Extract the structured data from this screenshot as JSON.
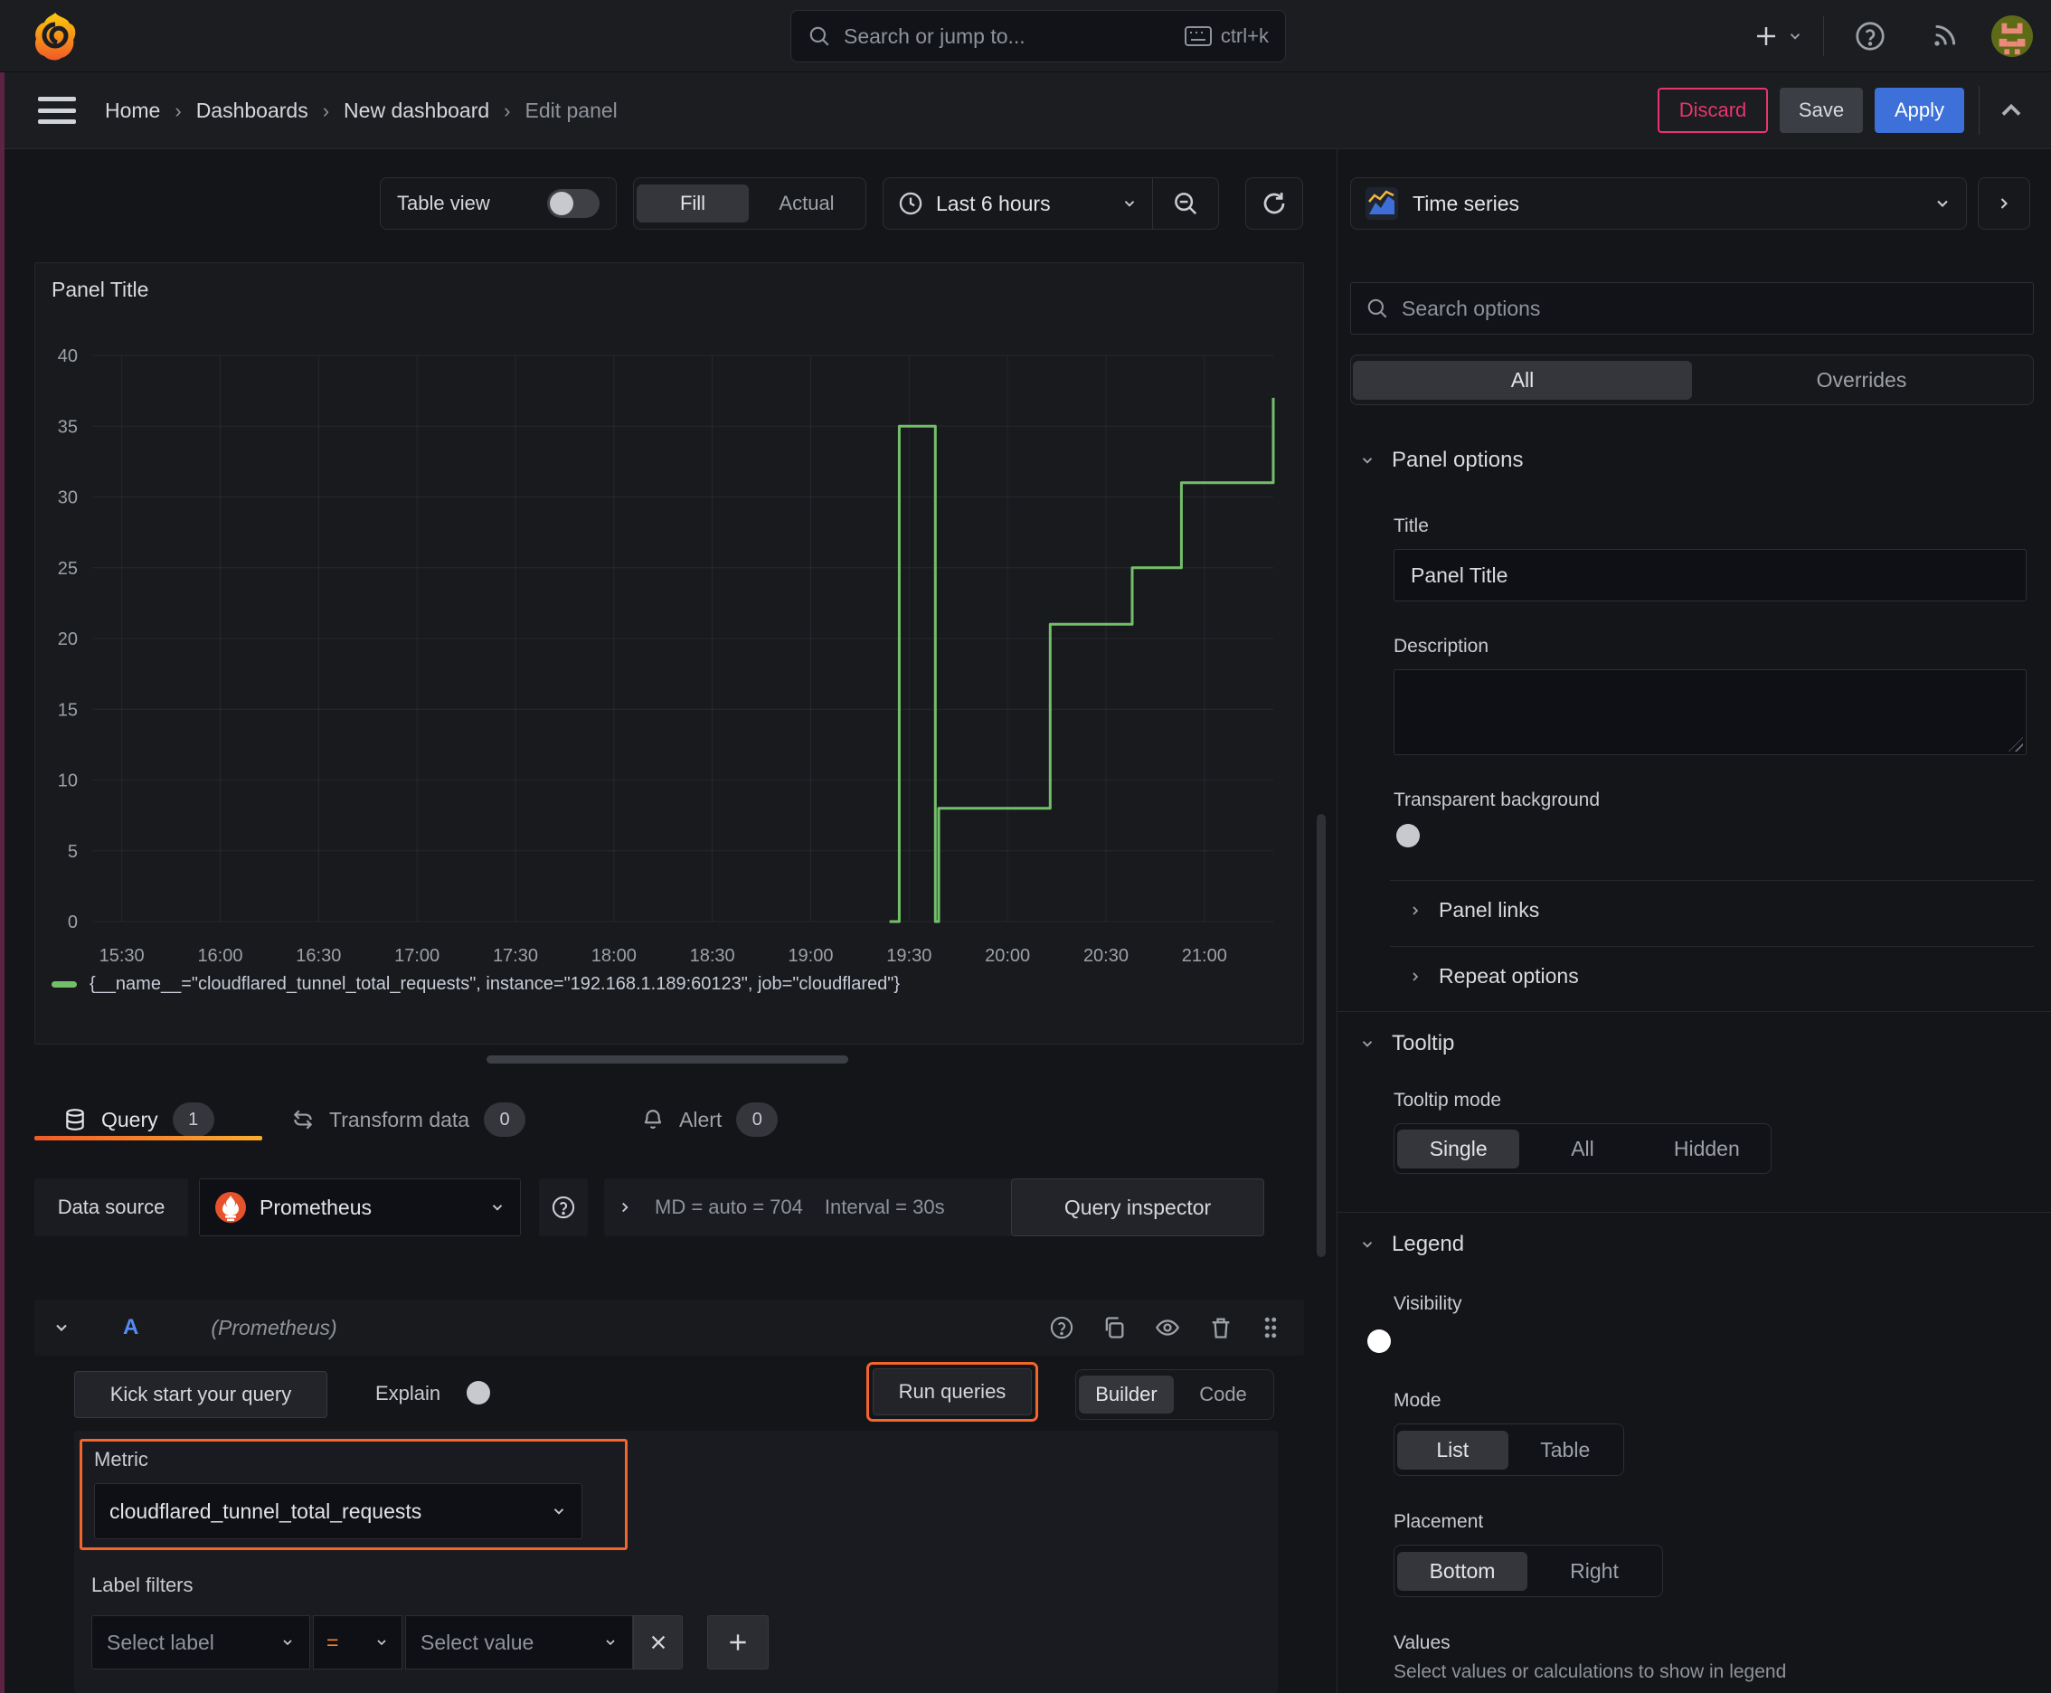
{
  "topbar": {
    "search_placeholder": "Search or jump to...",
    "search_shortcut": "ctrl+k"
  },
  "breadcrumb": {
    "items": [
      "Home",
      "Dashboards",
      "New dashboard",
      "Edit panel"
    ],
    "separator": "›"
  },
  "actions": {
    "discard": "Discard",
    "save": "Save",
    "apply": "Apply"
  },
  "toolbar": {
    "table_view_label": "Table view",
    "fill_label": "Fill",
    "actual_label": "Actual",
    "time_range_label": "Last 6 hours"
  },
  "panel": {
    "title": "Panel Title"
  },
  "chart_data": {
    "type": "line",
    "step": true,
    "title": "Panel Title",
    "x_range": [
      "15:21",
      "21:21"
    ],
    "x_ticks": [
      "15:30",
      "16:00",
      "16:30",
      "17:00",
      "17:30",
      "18:00",
      "18:30",
      "19:00",
      "19:30",
      "20:00",
      "20:30",
      "21:00"
    ],
    "ylim": [
      0,
      40
    ],
    "y_tick_step": 5,
    "grid": true,
    "legend_position": "bottom",
    "series": [
      {
        "name": "{__name__=\"cloudflared_tunnel_total_requests\", instance=\"192.168.1.189:60123\", job=\"cloudflared\"}",
        "color": "#73bf69",
        "points": [
          [
            "19:24",
            0
          ],
          [
            "19:27",
            0
          ],
          [
            "19:27",
            35
          ],
          [
            "19:38",
            35
          ],
          [
            "19:38",
            0
          ],
          [
            "19:39",
            0
          ],
          [
            "19:39",
            8
          ],
          [
            "20:13",
            8
          ],
          [
            "20:13",
            21
          ],
          [
            "20:38",
            21
          ],
          [
            "20:38",
            25
          ],
          [
            "20:53",
            25
          ],
          [
            "20:53",
            31
          ],
          [
            "21:21",
            31
          ],
          [
            "21:21",
            37
          ]
        ]
      }
    ]
  },
  "tabs": [
    {
      "label": "Query",
      "count": "1"
    },
    {
      "label": "Transform data",
      "count": "0"
    },
    {
      "label": "Alert",
      "count": "0"
    }
  ],
  "query": {
    "datasource_label": "Data source",
    "datasource_value": "Prometheus",
    "options_md": "MD = auto = 704",
    "options_interval": "Interval = 30s",
    "inspector_label": "Query inspector",
    "row_id": "A",
    "row_datasource": "(Prometheus)",
    "kick_start_label": "Kick start your query",
    "explain_label": "Explain",
    "run_queries_label": "Run queries",
    "builder_label": "Builder",
    "code_label": "Code",
    "metric_label": "Metric",
    "metric_value": "cloudflared_tunnel_total_requests",
    "label_filters_label": "Label filters",
    "select_label_placeholder": "Select label",
    "operator": "=",
    "select_value_placeholder": "Select value"
  },
  "sidebar": {
    "viz_type": "Time series",
    "search_placeholder": "Search options",
    "tab_all": "All",
    "tab_overrides": "Overrides",
    "panel_options": {
      "header": "Panel options",
      "title_label": "Title",
      "title_value": "Panel Title",
      "description_label": "Description",
      "transparent_label": "Transparent background"
    },
    "panel_links_label": "Panel links",
    "repeat_options_label": "Repeat options",
    "tooltip": {
      "header": "Tooltip",
      "mode_label": "Tooltip mode",
      "options": [
        "Single",
        "All",
        "Hidden"
      ],
      "selected": "Single"
    },
    "legend": {
      "header": "Legend",
      "visibility_label": "Visibility",
      "mode_label": "Mode",
      "modes": [
        "List",
        "Table"
      ],
      "selected_mode": "List",
      "placement_label": "Placement",
      "placements": [
        "Bottom",
        "Right"
      ],
      "selected_placement": "Bottom",
      "values_label": "Values",
      "values_hint": "Select values or calculations to show in legend"
    }
  },
  "colors": {
    "accent_orange": "#f4642c",
    "brand_gradient_start": "#f05a28",
    "brand_gradient_end": "#fbad2e",
    "series_green": "#73bf69",
    "apply_blue": "#3d71d9",
    "discard_pink": "#e8356d"
  }
}
